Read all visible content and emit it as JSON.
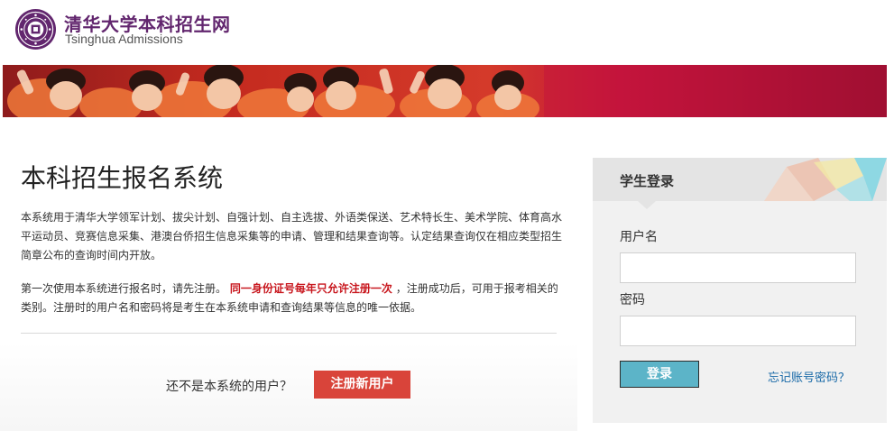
{
  "colors": {
    "brand_purple": "#62266e",
    "banner_red": "#c0103a",
    "register_red": "#d9443a",
    "login_teal": "#5cb4c8",
    "emphasis_red": "#c8171e",
    "link_blue": "#1a6aa8"
  },
  "header": {
    "logo_seal_text": "清华大学",
    "title_cn": "清华大学本科招生网",
    "title_en": "Tsinghua Admissions"
  },
  "banner": {
    "icon": "students-photo-banner"
  },
  "main": {
    "title": "本科招生报名系统",
    "intro": "本系统用于清华大学领军计划、拔尖计划、自强计划、自主选拔、外语类保送、艺术特长生、美术学院、体育高水平运动员、竞赛信息采集、港澳台侨招生信息采集等的申请、管理和结果查询等。认定结果查询仅在相应类型招生简章公布的查询时间内开放。",
    "notice_pre": "第一次使用本系统进行报名时，请先注册。",
    "notice_emph": "同一身份证号每年只允许注册一次",
    "notice_post": "，注册成功后，可用于报考相关的类别。注册时的用户名和密码将是考生在本系统申请和查询结果等信息的唯一依据。",
    "register_question": "还不是本系统的用户？",
    "register_button": "注册新用户"
  },
  "login": {
    "title": "学生登录",
    "username_label": "用户名",
    "username_value": "",
    "password_label": "密码",
    "password_value": "",
    "submit_label": "登录",
    "forgot_link": "忘记账号密码？"
  }
}
